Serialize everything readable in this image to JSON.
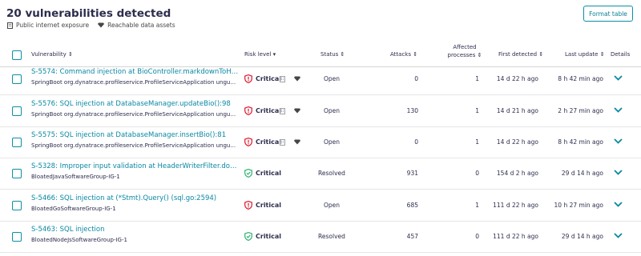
{
  "title": "20 vulnerabilities detected",
  "legend": {
    "internet_label": "Public internet exposure",
    "data_label": "Reachable data assets"
  },
  "format_button": "Format table",
  "columns": {
    "vulnerability": "Vulnerability ⇕",
    "risk_level": "Risk level ▾",
    "status": "Status ⇕",
    "attacks": "Attacks ⇕",
    "affected": "Affected processes ⇕",
    "first_detected": "First detected ⇕",
    "last_update": "Last update ⇕",
    "details": "Details"
  },
  "rows": [
    {
      "name": "S-5574: Command injection at BioController.markdownToHtm...",
      "sub": "SpringBoot org.dynatrace.profileservice.ProfileServiceApplication ungu...",
      "risk": "Critical",
      "risk_color": "#dc172a",
      "exposure": true,
      "status": "Open",
      "attacks": "0",
      "affected": "1",
      "first": "14 d 22 h ago",
      "last": "8 h 42 min ago"
    },
    {
      "name": "S-5576: SQL injection at DatabaseManager.updateBio():98",
      "sub": "SpringBoot org.dynatrace.profileservice.ProfileServiceApplication ungu...",
      "risk": "Critical",
      "risk_color": "#dc172a",
      "exposure": true,
      "status": "Open",
      "attacks": "130",
      "affected": "1",
      "first": "14 d 21 h ago",
      "last": "2 h 27 min ago"
    },
    {
      "name": "S-5575: SQL injection at DatabaseManager.insertBio():81",
      "sub": "SpringBoot org.dynatrace.profileservice.ProfileServiceApplication ungu...",
      "risk": "Critical",
      "risk_color": "#dc172a",
      "exposure": true,
      "status": "Open",
      "attacks": "0",
      "affected": "1",
      "first": "14 d 22 h ago",
      "last": "8 h 42 min ago"
    },
    {
      "name": "S-5328: Improper input validation at HeaderWriterFilter.doFil...",
      "sub": "BloatedJavaSoftwareGroup-IG-1",
      "risk": "Critical",
      "risk_color": "#2ab06f",
      "exposure": false,
      "status": "Resolved",
      "attacks": "931",
      "affected": "0",
      "first": "154 d 2 h ago",
      "last": "29 d 14 h ago"
    },
    {
      "name": "S-5466: SQL injection at (*Stmt).Query() (sql.go:2594)",
      "sub": "BloatedGoSoftwareGroup-IG-1",
      "risk": "Critical",
      "risk_color": "#dc172a",
      "exposure": false,
      "status": "Open",
      "attacks": "685",
      "affected": "1",
      "first": "111 d 22 h ago",
      "last": "10 h 27 min ago"
    },
    {
      "name": "S-5463: SQL injection",
      "sub": "BloatedNodeJsSoftwareGroup-IG-1",
      "risk": "Critical",
      "risk_color": "#2ab06f",
      "exposure": false,
      "status": "Resolved",
      "attacks": "457",
      "affected": "0",
      "first": "111 d 22 h ago",
      "last": "29 d 14 h ago"
    }
  ]
}
